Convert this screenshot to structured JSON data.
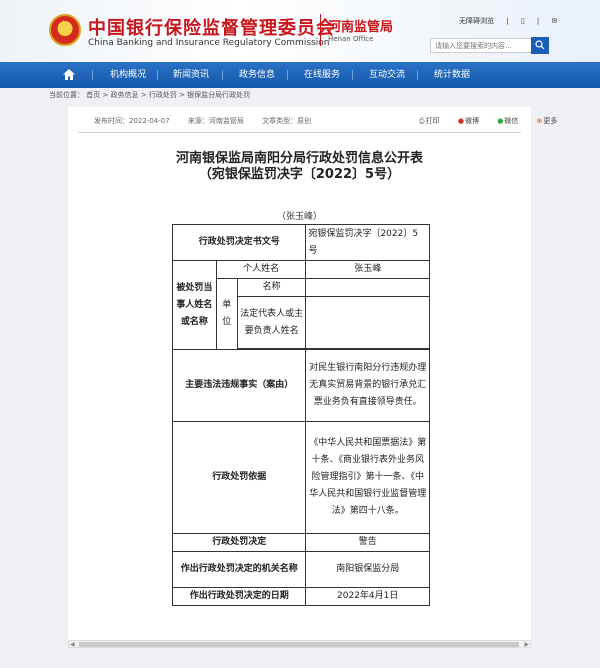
{
  "header": {
    "org_cn": "中国银行保险监督管理委员会",
    "org_en": "China Banking and Insurance Regulatory Commission",
    "office_cn": "河南监管局",
    "office_en": "Henan Office",
    "tool_accessible": "无障碍浏览",
    "tool_sep": "|",
    "search_placeholder": "请输入您要搜索的内容...",
    "brand_color": "#c8161d",
    "nav_color": "#1a5fb4"
  },
  "nav": {
    "items": [
      "机构概况",
      "新闻资讯",
      "政务信息",
      "在线服务",
      "互动交流",
      "统计数据"
    ]
  },
  "breadcrumb": "当前位置： 首页 > 政务信息 > 行政处罚 > 银保监分局行政处罚",
  "article": {
    "published": "发布时间：2022-04-07",
    "source": "来源：河南监管局",
    "type": "文章类型：原创",
    "share_print": "打印",
    "share_weibo": "微博",
    "share_wechat": "微信",
    "share_more": "更多",
    "title_line1": "河南银保监局南阳分局行政处罚信息公开表",
    "title_line2": "（宛银保监罚决字〔2022〕5号）",
    "person_caption": "（张玉峰）"
  },
  "penalty_table": {
    "doc_no_label": "行政处罚决定书文号",
    "doc_no": "宛银保监罚决字〔2022〕5号",
    "party_label": "被处罚当事人姓名或名称",
    "individual_label": "个人姓名",
    "individual_name": "张玉峰",
    "entity_label": "单位",
    "entity_name_label": "名称",
    "legal_rep_label": "法定代表人或主要负责人姓名",
    "violation_label": "主要违法违规事实（案由）",
    "violation": "对民生银行南阳分行违规办理无真实贸易背景的银行承兑汇票业务负有直接领导责任。",
    "basis_label": "行政处罚依据",
    "basis": "《中华人民共和国票据法》第十条、《商业银行表外业务风险管理指引》第十一条、《中华人民共和国银行业监督管理法》第四十八条。",
    "decision_label": "行政处罚决定",
    "decision": "警告",
    "authority_label": "作出行政处罚决定的机关名称",
    "authority": "南阳银保监分局",
    "date_label": "作出行政处罚决定的日期",
    "date": "2022年4月1日"
  }
}
